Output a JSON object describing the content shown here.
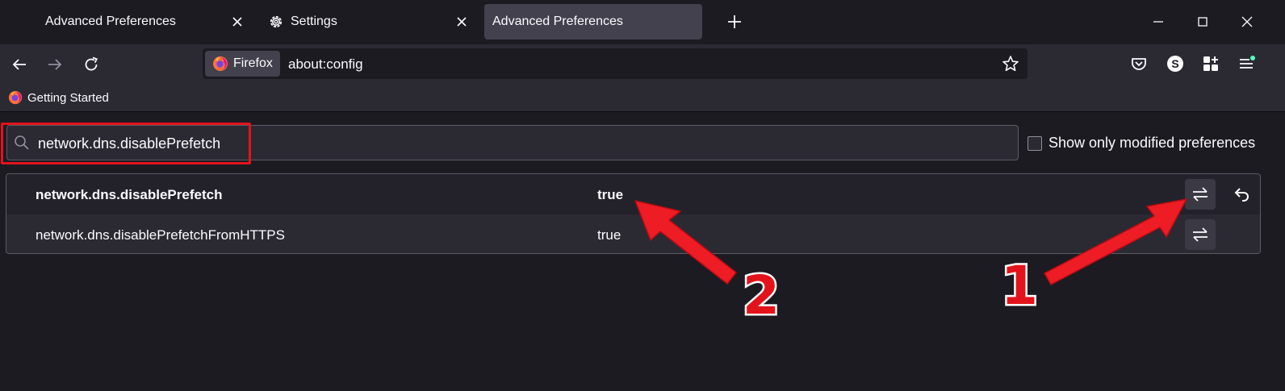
{
  "tabs": [
    {
      "title": "Advanced Preferences",
      "has_icon": false,
      "active": false
    },
    {
      "title": "Settings",
      "icon": "gear-icon",
      "active": false
    },
    {
      "title": "Advanced Preferences",
      "has_icon": false,
      "active": true
    }
  ],
  "urlbar": {
    "identity_label": "Firefox",
    "url": "about:config"
  },
  "toolbar_icons": [
    "pocket-icon",
    "account-avatar-icon",
    "extensions-icon",
    "app-menu-icon"
  ],
  "account": {
    "initial": "S"
  },
  "bookmarks": [
    {
      "label": "Getting Started",
      "icon": "firefox-icon"
    }
  ],
  "config": {
    "search_value": "network.dns.disablePrefetch",
    "show_modified_label": "Show only modified preferences",
    "show_modified_checked": false,
    "prefs": [
      {
        "name": "network.dns.disablePrefetch",
        "value": "true",
        "modified": true
      },
      {
        "name": "network.dns.disablePrefetchFromHTTPS",
        "value": "true",
        "modified": false
      }
    ]
  },
  "annotations": {
    "marker_1": "1",
    "marker_2": "2",
    "color": "#e3131b"
  },
  "colors": {
    "background": "#1c1b22",
    "toolbar": "#2b2a33",
    "active_tab": "#42414d",
    "text": "#fbfbfe",
    "highlight": "#e3131b"
  }
}
